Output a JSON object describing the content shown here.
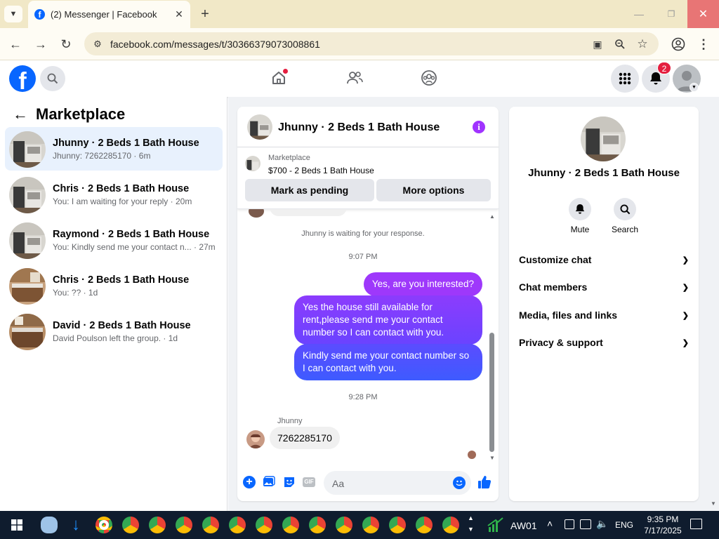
{
  "browser": {
    "tab_title": "(2) Messenger | Facebook",
    "url": "facebook.com/messages/t/30366379073008861"
  },
  "fb_header": {
    "notif_count": "2"
  },
  "sidebar": {
    "title": "Marketplace",
    "conversations": [
      {
        "name": "Jhunny · 2 Beds 1 Bath House",
        "preview": "Jhunny: 7262285170 · 6m"
      },
      {
        "name": "Chris · 2 Beds 1 Bath House",
        "preview": "You: I am waiting for your reply · 20m"
      },
      {
        "name": "Raymond · 2 Beds 1 Bath House",
        "preview": "You: Kindly send me your contact n... · 27m"
      },
      {
        "name": "Chris · 2 Beds 1 Bath House",
        "preview": "You: ?? · 1d"
      },
      {
        "name": "David · 2 Beds 1 Bath House",
        "preview": "David Poulson left the group. · 1d"
      }
    ]
  },
  "chat": {
    "title": "Jhunny · 2 Beds 1 Bath House",
    "listing": {
      "source": "Marketplace",
      "detail": "$700 - 2 Beds 1 Bath House"
    },
    "buttons": {
      "pending": "Mark as pending",
      "more": "More options"
    },
    "waiting_note": "Jhunny is waiting for your response.",
    "time1": "9:07 PM",
    "time2": "9:28 PM",
    "messages": [
      "Yes, are you interested?",
      "Yes the house still available for rent,please send me your contact number so I can contact with you.",
      "Kindly  send me your contact number so I can contact with you."
    ],
    "sender_name": "Jhunny",
    "incoming": "7262285170",
    "composer_placeholder": "Aa",
    "gif_label": "GIF"
  },
  "info_panel": {
    "title": "Jhunny · 2 Beds 1 Bath House",
    "mute": "Mute",
    "search": "Search",
    "sections": [
      "Customize chat",
      "Chat members",
      "Media, files and links",
      "Privacy & support"
    ]
  },
  "taskbar": {
    "tray_label": "AW01",
    "lang": "ENG",
    "time": "9:35 PM",
    "date": "7/17/2025"
  },
  "colors": {
    "fb_blue": "#0866ff",
    "bubble_top": "#a033ff",
    "bubble_bottom": "#3e5bff",
    "chrome_tabbar": "#f1e8c7"
  }
}
